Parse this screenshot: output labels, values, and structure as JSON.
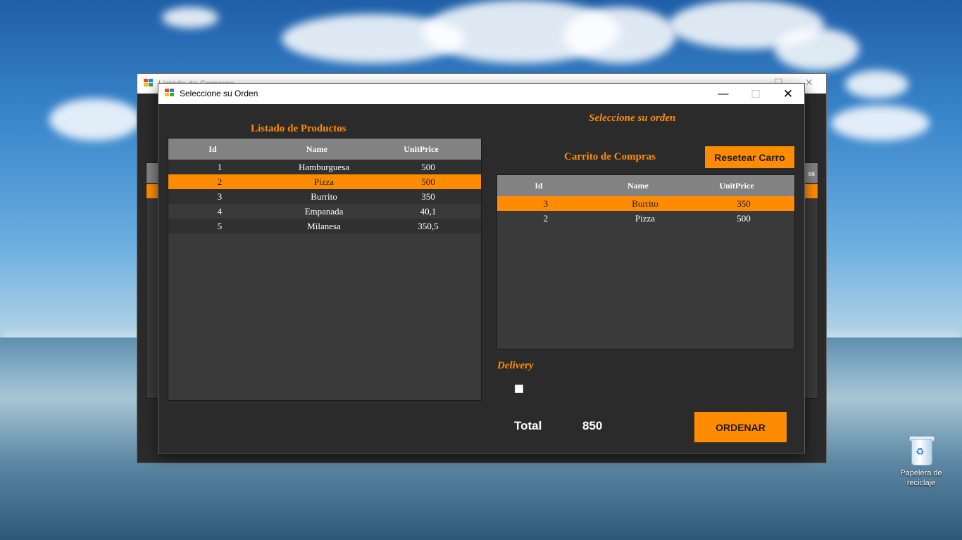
{
  "desktop": {
    "recycle_bin_label_line1": "Papelera de",
    "recycle_bin_label_line2": "reciclaje"
  },
  "parent_window": {
    "title": "Listado de Compras",
    "grid_header_fragment": "ss"
  },
  "dialog": {
    "title": "Seleccione su Orden",
    "controls": {
      "minimize": "—",
      "maximize": "☐",
      "close": "✕"
    },
    "products": {
      "title": "Listado de Productos",
      "columns": [
        "Id",
        "Name",
        "UnitPrice"
      ],
      "rows": [
        {
          "id": "1",
          "name": "Hamburguesa",
          "price": "500"
        },
        {
          "id": "2",
          "name": "Pizza",
          "price": "500"
        },
        {
          "id": "3",
          "name": "Burrito",
          "price": "350"
        },
        {
          "id": "4",
          "name": "Empanada",
          "price": "40,1"
        },
        {
          "id": "5",
          "name": "Milanesa",
          "price": "350,5"
        }
      ],
      "selected_index": 1
    },
    "order": {
      "heading": "Seleccione su orden",
      "cart_title": "Carrito de Compras",
      "reset_button": "Resetear Carro",
      "columns": [
        "Id",
        "Name",
        "UnitPrice"
      ],
      "rows": [
        {
          "id": "3",
          "name": "Burrito",
          "price": "350"
        },
        {
          "id": "2",
          "name": "Pizza",
          "price": "500"
        }
      ],
      "selected_index": 0
    },
    "delivery": {
      "label": "Delivery",
      "checked": false
    },
    "total": {
      "label": "Total",
      "value": "850"
    },
    "order_button": "ORDENAR"
  },
  "colors": {
    "accent": "#ff8c00",
    "panel_bg": "#2b2b2b",
    "grid_bg": "#3a3a3a",
    "grid_header": "#828282"
  }
}
